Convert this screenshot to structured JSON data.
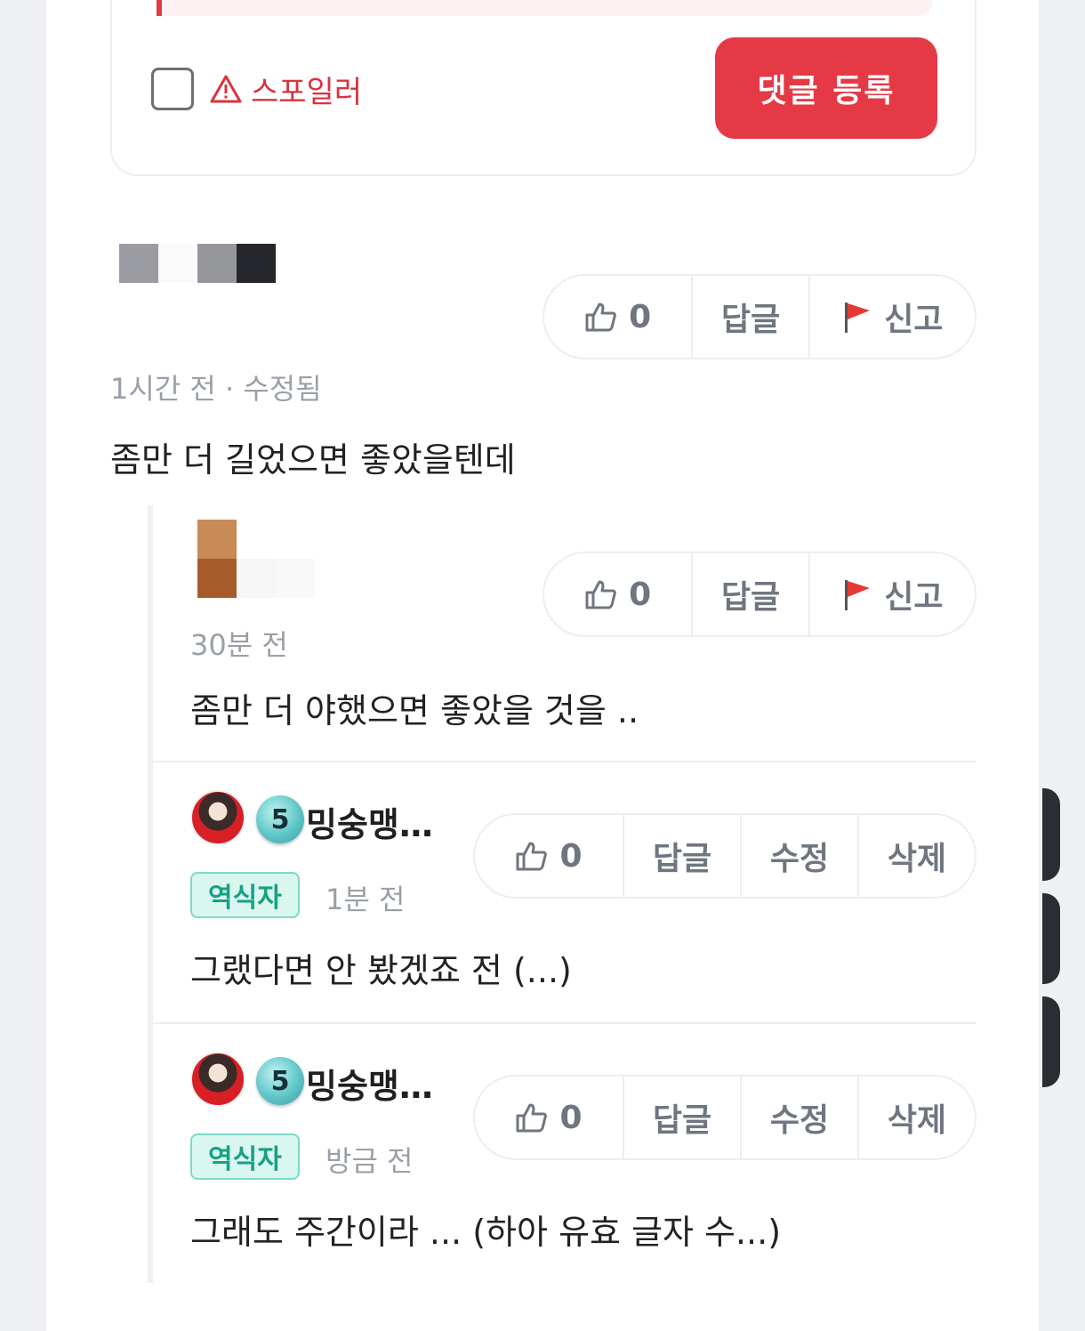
{
  "composer": {
    "spoiler_label": "스포일러",
    "submit_label": "댓글 등록"
  },
  "comments": [
    {
      "time": "1시간 전 · 수정됨",
      "content": "좀만 더 길었으면 좋았을텐데",
      "actions": {
        "like_count": "0",
        "reply_label": "답글",
        "report_label": "신고"
      }
    },
    {
      "time": "30분 전",
      "content": "좀만 더 야했으면 좋았을 것을 ..",
      "actions": {
        "like_count": "0",
        "reply_label": "답글",
        "report_label": "신고"
      }
    },
    {
      "username": "밍숭맹…",
      "level": "5",
      "role": "역식자",
      "time": "1분 전",
      "content": "그랬다면 안 봤겠죠 전 (...)",
      "actions": {
        "like_count": "0",
        "reply_label": "답글",
        "edit_label": "수정",
        "delete_label": "삭제"
      }
    },
    {
      "username": "밍숭맹…",
      "level": "5",
      "role": "역식자",
      "time": "방금 전",
      "content": "그래도 주간이라 ... (하아 유효 글자 수...)",
      "actions": {
        "like_count": "0",
        "reply_label": "답글",
        "edit_label": "수정",
        "delete_label": "삭제"
      }
    }
  ],
  "colors": {
    "accent": "#e63946",
    "role_badge": "#18a083",
    "muted": "#9aa0a8"
  },
  "icons": [
    "warning-icon",
    "thumbs-up-icon",
    "red-flag-icon"
  ]
}
